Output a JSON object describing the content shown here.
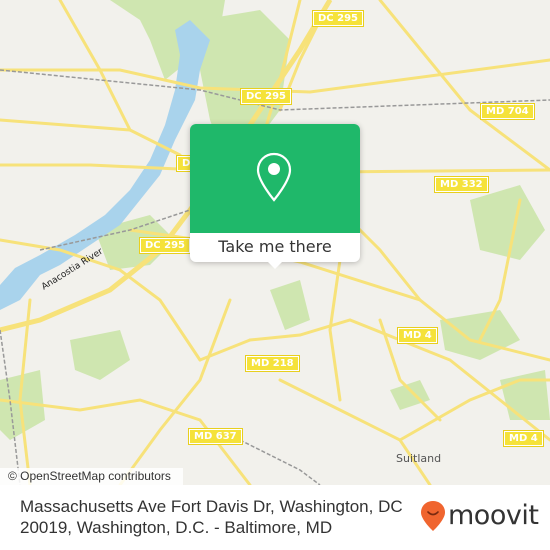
{
  "map": {
    "attribution": "© OpenStreetMap contributors",
    "colors": {
      "background": "#f2f1ec",
      "water": "#a9d3ec",
      "park": "#cfe6b0",
      "road": "#f7e27a",
      "road_casing": "#e8cf5a",
      "rail": "#999999",
      "popup_green": "#1fb86a",
      "brand_orange": "#f0652f"
    },
    "road_shields": [
      {
        "label": "DC 295"
      },
      {
        "label": "DC 295"
      },
      {
        "label": "MD 704"
      },
      {
        "label": "DC 295"
      },
      {
        "label": "MD 332"
      },
      {
        "label": "DC 295"
      },
      {
        "label": "MD 4"
      },
      {
        "label": "MD 218"
      },
      {
        "label": "MD 637"
      },
      {
        "label": "MD 4"
      }
    ],
    "place_labels": {
      "river": "Anacostia River",
      "town": "Suitland"
    }
  },
  "popup": {
    "icon": "map-pin-icon",
    "cta_label": "Take me there"
  },
  "footer": {
    "address": "Massachusetts Ave Fort Davis Dr, Washington, DC 20019, Washington, D.C. - Baltimore, MD",
    "logo_text": "moovit"
  }
}
